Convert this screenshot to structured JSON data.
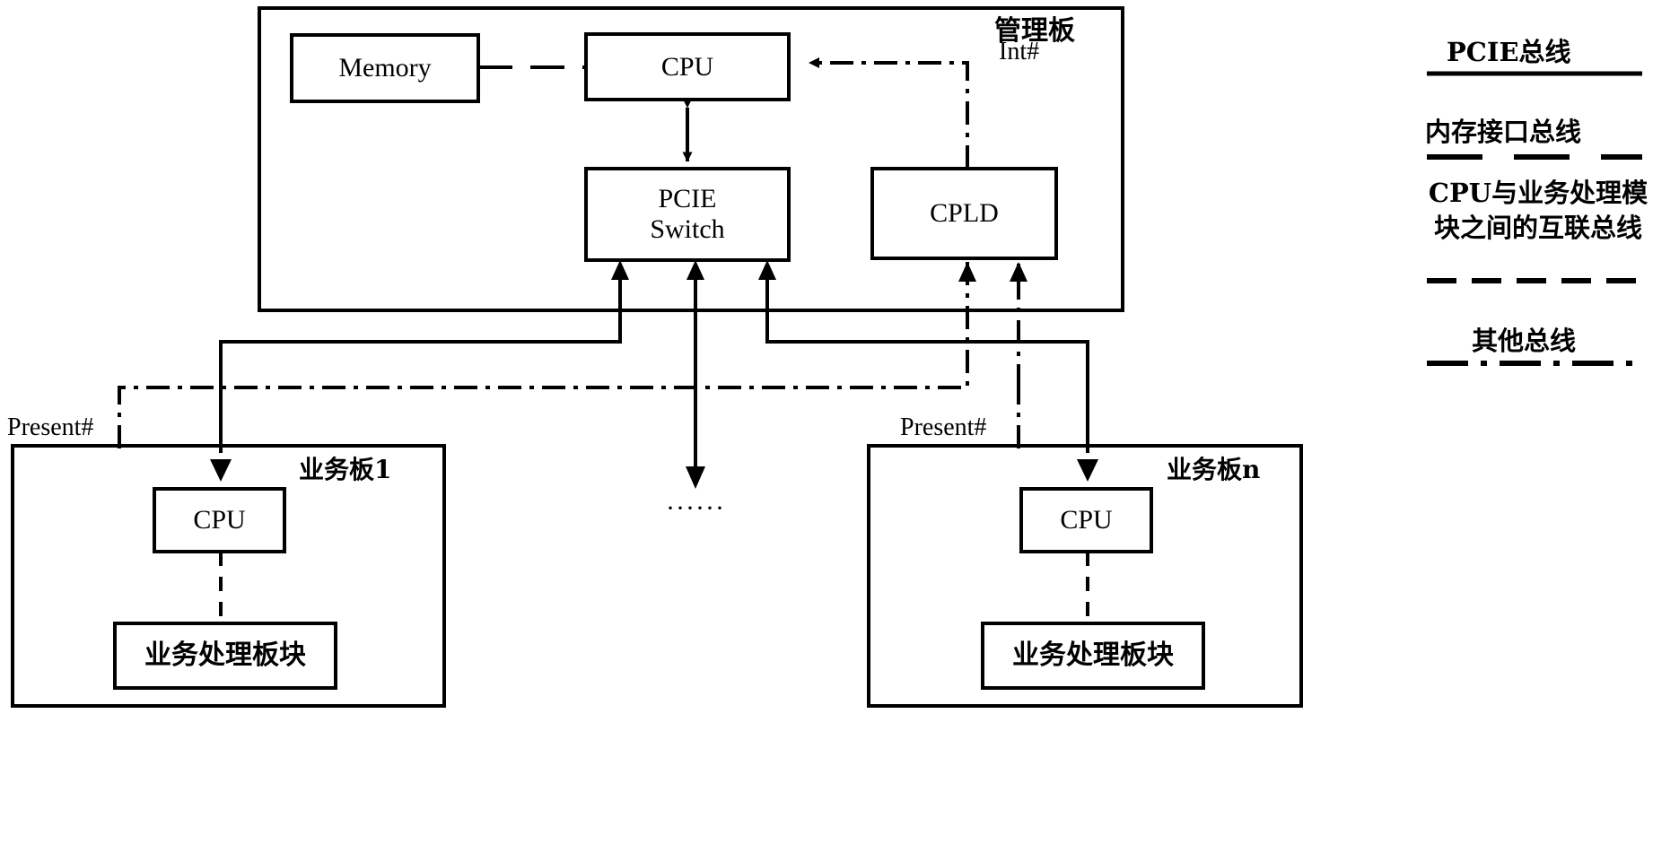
{
  "diagram": {
    "title_note": "Management board and service board PCIE architecture",
    "management_board": {
      "label": "管理板",
      "boxes": {
        "memory": "Memory",
        "cpu": "CPU",
        "pcie_switch": "PCIE\nSwitch",
        "cpld": "CPLD"
      },
      "signals": {
        "interrupt": "Int#"
      }
    },
    "service_board_1": {
      "label": "业务板1",
      "present_signal": "Present#",
      "boxes": {
        "cpu": "CPU",
        "module": "业务处理板块"
      }
    },
    "service_board_n": {
      "label": "业务板n",
      "present_signal": "Present#",
      "boxes": {
        "cpu": "CPU",
        "module": "业务处理板块"
      }
    },
    "ellipsis": "······",
    "legend": {
      "items": [
        {
          "label": "PCIE总线",
          "style": "solid"
        },
        {
          "label": "内存接口总线",
          "style": "long-dash"
        },
        {
          "label": "CPU与业务处理模\n块之间的互联总线",
          "style": "dashed"
        },
        {
          "label": "其他总线",
          "style": "dash-dot"
        }
      ]
    },
    "colors": {
      "stroke": "#000000",
      "background": "#ffffff"
    }
  }
}
